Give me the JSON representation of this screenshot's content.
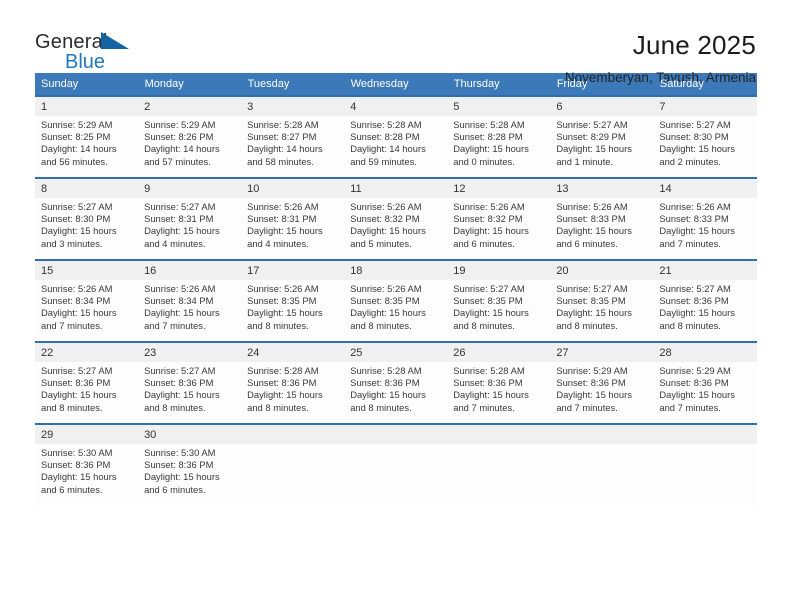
{
  "brand": {
    "line1": "General",
    "line2": "Blue",
    "accent_color": "#1f77bf",
    "triangle_color": "#1464a5"
  },
  "header": {
    "title": "June 2025",
    "subtitle": "Noyemberyan, Tavush, Armenia"
  },
  "calendar": {
    "header_bg": "#3b79b8",
    "row_divider_color": "#2f6fb0",
    "daynum_bg": "#f0f0f0",
    "weekday_headers": [
      "Sunday",
      "Monday",
      "Tuesday",
      "Wednesday",
      "Thursday",
      "Friday",
      "Saturday"
    ],
    "weeks": [
      [
        {
          "day": "1",
          "sunrise": "Sunrise: 5:29 AM",
          "sunset": "Sunset: 8:25 PM",
          "daylight_line1": "Daylight: 14 hours",
          "daylight_line2": "and 56 minutes."
        },
        {
          "day": "2",
          "sunrise": "Sunrise: 5:29 AM",
          "sunset": "Sunset: 8:26 PM",
          "daylight_line1": "Daylight: 14 hours",
          "daylight_line2": "and 57 minutes."
        },
        {
          "day": "3",
          "sunrise": "Sunrise: 5:28 AM",
          "sunset": "Sunset: 8:27 PM",
          "daylight_line1": "Daylight: 14 hours",
          "daylight_line2": "and 58 minutes."
        },
        {
          "day": "4",
          "sunrise": "Sunrise: 5:28 AM",
          "sunset": "Sunset: 8:28 PM",
          "daylight_line1": "Daylight: 14 hours",
          "daylight_line2": "and 59 minutes."
        },
        {
          "day": "5",
          "sunrise": "Sunrise: 5:28 AM",
          "sunset": "Sunset: 8:28 PM",
          "daylight_line1": "Daylight: 15 hours",
          "daylight_line2": "and 0 minutes."
        },
        {
          "day": "6",
          "sunrise": "Sunrise: 5:27 AM",
          "sunset": "Sunset: 8:29 PM",
          "daylight_line1": "Daylight: 15 hours",
          "daylight_line2": "and 1 minute."
        },
        {
          "day": "7",
          "sunrise": "Sunrise: 5:27 AM",
          "sunset": "Sunset: 8:30 PM",
          "daylight_line1": "Daylight: 15 hours",
          "daylight_line2": "and 2 minutes."
        }
      ],
      [
        {
          "day": "8",
          "sunrise": "Sunrise: 5:27 AM",
          "sunset": "Sunset: 8:30 PM",
          "daylight_line1": "Daylight: 15 hours",
          "daylight_line2": "and 3 minutes."
        },
        {
          "day": "9",
          "sunrise": "Sunrise: 5:27 AM",
          "sunset": "Sunset: 8:31 PM",
          "daylight_line1": "Daylight: 15 hours",
          "daylight_line2": "and 4 minutes."
        },
        {
          "day": "10",
          "sunrise": "Sunrise: 5:26 AM",
          "sunset": "Sunset: 8:31 PM",
          "daylight_line1": "Daylight: 15 hours",
          "daylight_line2": "and 4 minutes."
        },
        {
          "day": "11",
          "sunrise": "Sunrise: 5:26 AM",
          "sunset": "Sunset: 8:32 PM",
          "daylight_line1": "Daylight: 15 hours",
          "daylight_line2": "and 5 minutes."
        },
        {
          "day": "12",
          "sunrise": "Sunrise: 5:26 AM",
          "sunset": "Sunset: 8:32 PM",
          "daylight_line1": "Daylight: 15 hours",
          "daylight_line2": "and 6 minutes."
        },
        {
          "day": "13",
          "sunrise": "Sunrise: 5:26 AM",
          "sunset": "Sunset: 8:33 PM",
          "daylight_line1": "Daylight: 15 hours",
          "daylight_line2": "and 6 minutes."
        },
        {
          "day": "14",
          "sunrise": "Sunrise: 5:26 AM",
          "sunset": "Sunset: 8:33 PM",
          "daylight_line1": "Daylight: 15 hours",
          "daylight_line2": "and 7 minutes."
        }
      ],
      [
        {
          "day": "15",
          "sunrise": "Sunrise: 5:26 AM",
          "sunset": "Sunset: 8:34 PM",
          "daylight_line1": "Daylight: 15 hours",
          "daylight_line2": "and 7 minutes."
        },
        {
          "day": "16",
          "sunrise": "Sunrise: 5:26 AM",
          "sunset": "Sunset: 8:34 PM",
          "daylight_line1": "Daylight: 15 hours",
          "daylight_line2": "and 7 minutes."
        },
        {
          "day": "17",
          "sunrise": "Sunrise: 5:26 AM",
          "sunset": "Sunset: 8:35 PM",
          "daylight_line1": "Daylight: 15 hours",
          "daylight_line2": "and 8 minutes."
        },
        {
          "day": "18",
          "sunrise": "Sunrise: 5:26 AM",
          "sunset": "Sunset: 8:35 PM",
          "daylight_line1": "Daylight: 15 hours",
          "daylight_line2": "and 8 minutes."
        },
        {
          "day": "19",
          "sunrise": "Sunrise: 5:27 AM",
          "sunset": "Sunset: 8:35 PM",
          "daylight_line1": "Daylight: 15 hours",
          "daylight_line2": "and 8 minutes."
        },
        {
          "day": "20",
          "sunrise": "Sunrise: 5:27 AM",
          "sunset": "Sunset: 8:35 PM",
          "daylight_line1": "Daylight: 15 hours",
          "daylight_line2": "and 8 minutes."
        },
        {
          "day": "21",
          "sunrise": "Sunrise: 5:27 AM",
          "sunset": "Sunset: 8:36 PM",
          "daylight_line1": "Daylight: 15 hours",
          "daylight_line2": "and 8 minutes."
        }
      ],
      [
        {
          "day": "22",
          "sunrise": "Sunrise: 5:27 AM",
          "sunset": "Sunset: 8:36 PM",
          "daylight_line1": "Daylight: 15 hours",
          "daylight_line2": "and 8 minutes."
        },
        {
          "day": "23",
          "sunrise": "Sunrise: 5:27 AM",
          "sunset": "Sunset: 8:36 PM",
          "daylight_line1": "Daylight: 15 hours",
          "daylight_line2": "and 8 minutes."
        },
        {
          "day": "24",
          "sunrise": "Sunrise: 5:28 AM",
          "sunset": "Sunset: 8:36 PM",
          "daylight_line1": "Daylight: 15 hours",
          "daylight_line2": "and 8 minutes."
        },
        {
          "day": "25",
          "sunrise": "Sunrise: 5:28 AM",
          "sunset": "Sunset: 8:36 PM",
          "daylight_line1": "Daylight: 15 hours",
          "daylight_line2": "and 8 minutes."
        },
        {
          "day": "26",
          "sunrise": "Sunrise: 5:28 AM",
          "sunset": "Sunset: 8:36 PM",
          "daylight_line1": "Daylight: 15 hours",
          "daylight_line2": "and 7 minutes."
        },
        {
          "day": "27",
          "sunrise": "Sunrise: 5:29 AM",
          "sunset": "Sunset: 8:36 PM",
          "daylight_line1": "Daylight: 15 hours",
          "daylight_line2": "and 7 minutes."
        },
        {
          "day": "28",
          "sunrise": "Sunrise: 5:29 AM",
          "sunset": "Sunset: 8:36 PM",
          "daylight_line1": "Daylight: 15 hours",
          "daylight_line2": "and 7 minutes."
        }
      ],
      [
        {
          "day": "29",
          "sunrise": "Sunrise: 5:30 AM",
          "sunset": "Sunset: 8:36 PM",
          "daylight_line1": "Daylight: 15 hours",
          "daylight_line2": "and 6 minutes."
        },
        {
          "day": "30",
          "sunrise": "Sunrise: 5:30 AM",
          "sunset": "Sunset: 8:36 PM",
          "daylight_line1": "Daylight: 15 hours",
          "daylight_line2": "and 6 minutes."
        },
        {
          "day": "",
          "sunrise": "",
          "sunset": "",
          "daylight_line1": "",
          "daylight_line2": ""
        },
        {
          "day": "",
          "sunrise": "",
          "sunset": "",
          "daylight_line1": "",
          "daylight_line2": ""
        },
        {
          "day": "",
          "sunrise": "",
          "sunset": "",
          "daylight_line1": "",
          "daylight_line2": ""
        },
        {
          "day": "",
          "sunrise": "",
          "sunset": "",
          "daylight_line1": "",
          "daylight_line2": ""
        },
        {
          "day": "",
          "sunrise": "",
          "sunset": "",
          "daylight_line1": "",
          "daylight_line2": ""
        }
      ]
    ]
  }
}
